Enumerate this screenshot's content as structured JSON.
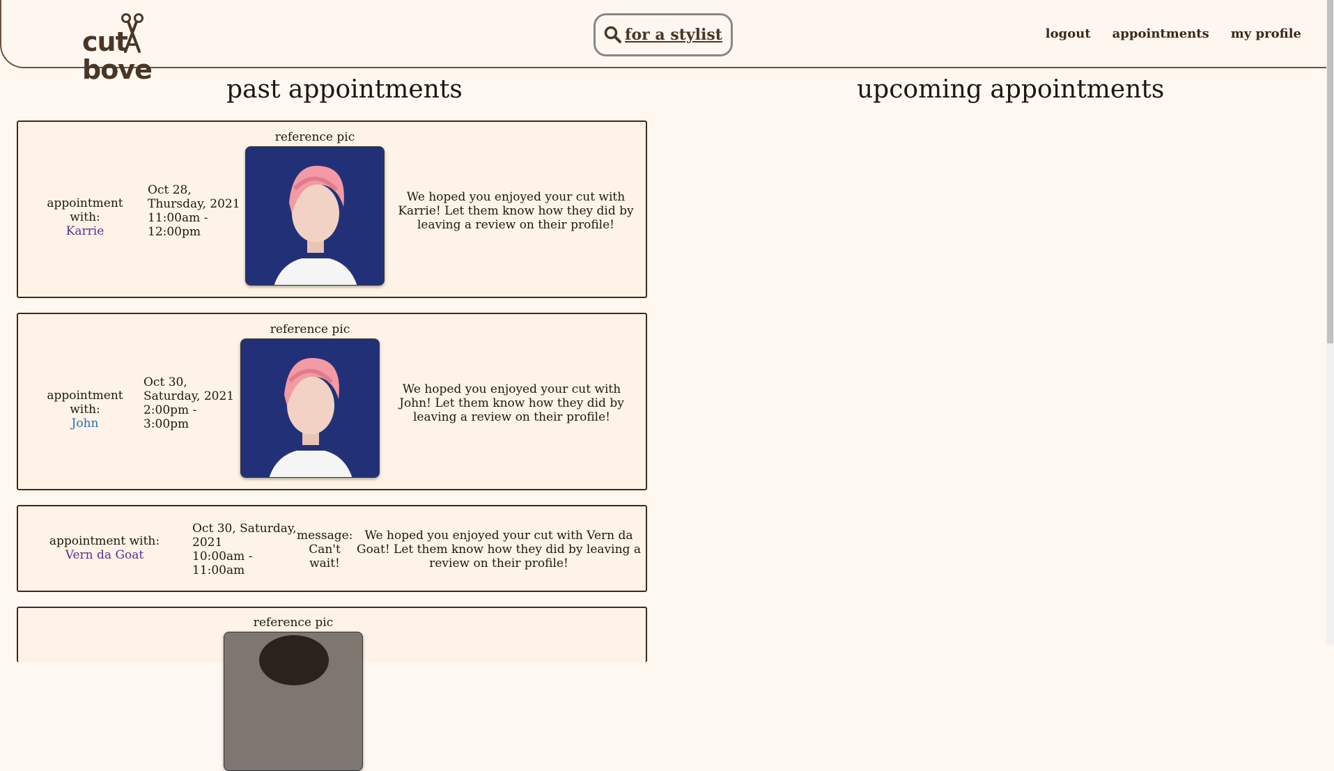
{
  "header": {
    "logo_text_left": "cut",
    "logo_text_right": "bove",
    "search_label": "for a stylist",
    "nav": [
      "logout",
      "appointments",
      "my profile"
    ]
  },
  "past": {
    "title": "past appointments",
    "cards": [
      {
        "with_label": "appointment with:",
        "stylist": "Karrie",
        "date_lines": [
          "Oct 28,",
          "Thursday, 2021",
          "11:00am -",
          "12:00pm"
        ],
        "ref_label": "reference pic",
        "message": "We hoped you enjoyed your cut with Karrie! Let them know how they did by leaving a review on their profile!"
      },
      {
        "with_label": "appointment with:",
        "stylist": "John",
        "date_lines": [
          "Oct 30,",
          "Saturday, 2021",
          "2:00pm -",
          "3:00pm"
        ],
        "ref_label": "reference pic",
        "message": "We hoped you enjoyed your cut with John! Let them know how they did by leaving a review on their profile!"
      },
      {
        "with_label": "appointment with:",
        "stylist": "Vern da Goat",
        "date_lines": [
          "Oct 30, Saturday,",
          "2021",
          "10:00am -",
          "11:00am"
        ],
        "note_label": "message:",
        "note": "Can't wait!",
        "message": "We hoped you enjoyed your cut with Vern da Goat! Let them know how they did by leaving a review on their profile!"
      },
      {
        "ref_label": "reference pic"
      }
    ]
  },
  "upcoming": {
    "title": "upcoming appointments"
  },
  "colors": {
    "background": "#fef8f1",
    "card_bg": "#fef3e6",
    "accent_brown": "#4a3626",
    "link_purple": "#5b2c8e",
    "link_blue": "#1f6fb5"
  },
  "icons": [
    "scissors-icon",
    "search-icon"
  ]
}
